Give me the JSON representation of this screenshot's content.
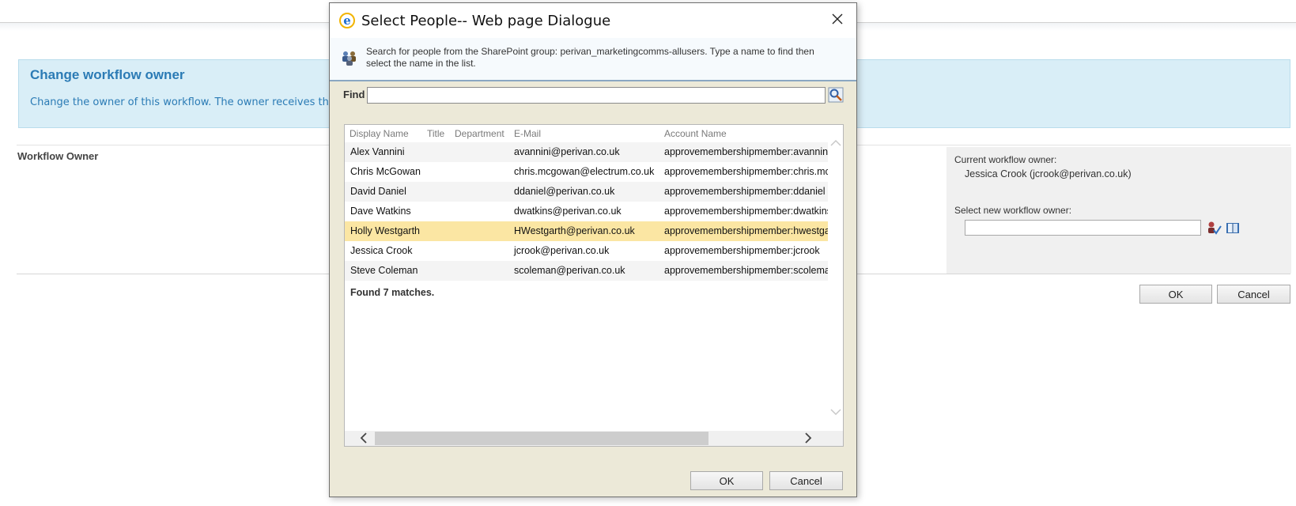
{
  "page": {
    "banner_title": "Change workflow owner",
    "banner_desc": "Change the owner of this workflow. The owner receives the",
    "workflow_owner_label": "Workflow Owner",
    "current_owner_label": "Current workflow owner:",
    "current_owner_value": "Jessica Crook (jcrook@perivan.co.uk)",
    "select_new_owner_label": "Select new workflow owner:",
    "new_owner_value": "",
    "ok_label": "OK",
    "cancel_label": "Cancel"
  },
  "dialog": {
    "title": "Select People-- Web page Dialogue",
    "intro": "Search for people from the SharePoint group: perivan_marketingcomms-allusers. Type a name to find then select the name in the list.",
    "find_label": "Find",
    "find_value": "",
    "columns": [
      "Display Name",
      "Title",
      "Department",
      "E-Mail",
      "Account Name"
    ],
    "rows": [
      {
        "name": "Alex Vannini",
        "title": "",
        "department": "",
        "email": "avannini@perivan.co.uk",
        "account": "approvemembershipmember:avannini"
      },
      {
        "name": "Chris McGowan",
        "title": "",
        "department": "",
        "email": "chris.mcgowan@electrum.co.uk",
        "account": "approvemembershipmember:chris.mcgowan"
      },
      {
        "name": "David Daniel",
        "title": "",
        "department": "",
        "email": "ddaniel@perivan.co.uk",
        "account": "approvemembershipmember:ddaniel"
      },
      {
        "name": "Dave Watkins",
        "title": "",
        "department": "",
        "email": "dwatkins@perivan.co.uk",
        "account": "approvemembershipmember:dwatkins"
      },
      {
        "name": "Holly Westgarth",
        "title": "",
        "department": "",
        "email": "HWestgarth@perivan.co.uk",
        "account": "approvemembershipmember:hwestgarth"
      },
      {
        "name": "Jessica Crook",
        "title": "",
        "department": "",
        "email": "jcrook@perivan.co.uk",
        "account": "approvemembershipmember:jcrook"
      },
      {
        "name": "Steve Coleman",
        "title": "",
        "department": "",
        "email": "scoleman@perivan.co.uk",
        "account": "approvemembershipmember:scoleman"
      }
    ],
    "selected_row": 4,
    "found_text": "Found 7 matches.",
    "ok_label": "OK",
    "cancel_label": "Cancel"
  },
  "colors": {
    "banner_bg": "#d9eef7",
    "banner_text": "#2b7bb5",
    "dialog_bg": "#ece9d8",
    "selected_row": "#fbe6a3"
  },
  "icons": {
    "title": "internet-explorer-icon",
    "intro": "people-group-icon",
    "find": "search-people-icon",
    "check_names": "check-names-icon",
    "browse": "address-book-icon",
    "close": "close-icon"
  }
}
